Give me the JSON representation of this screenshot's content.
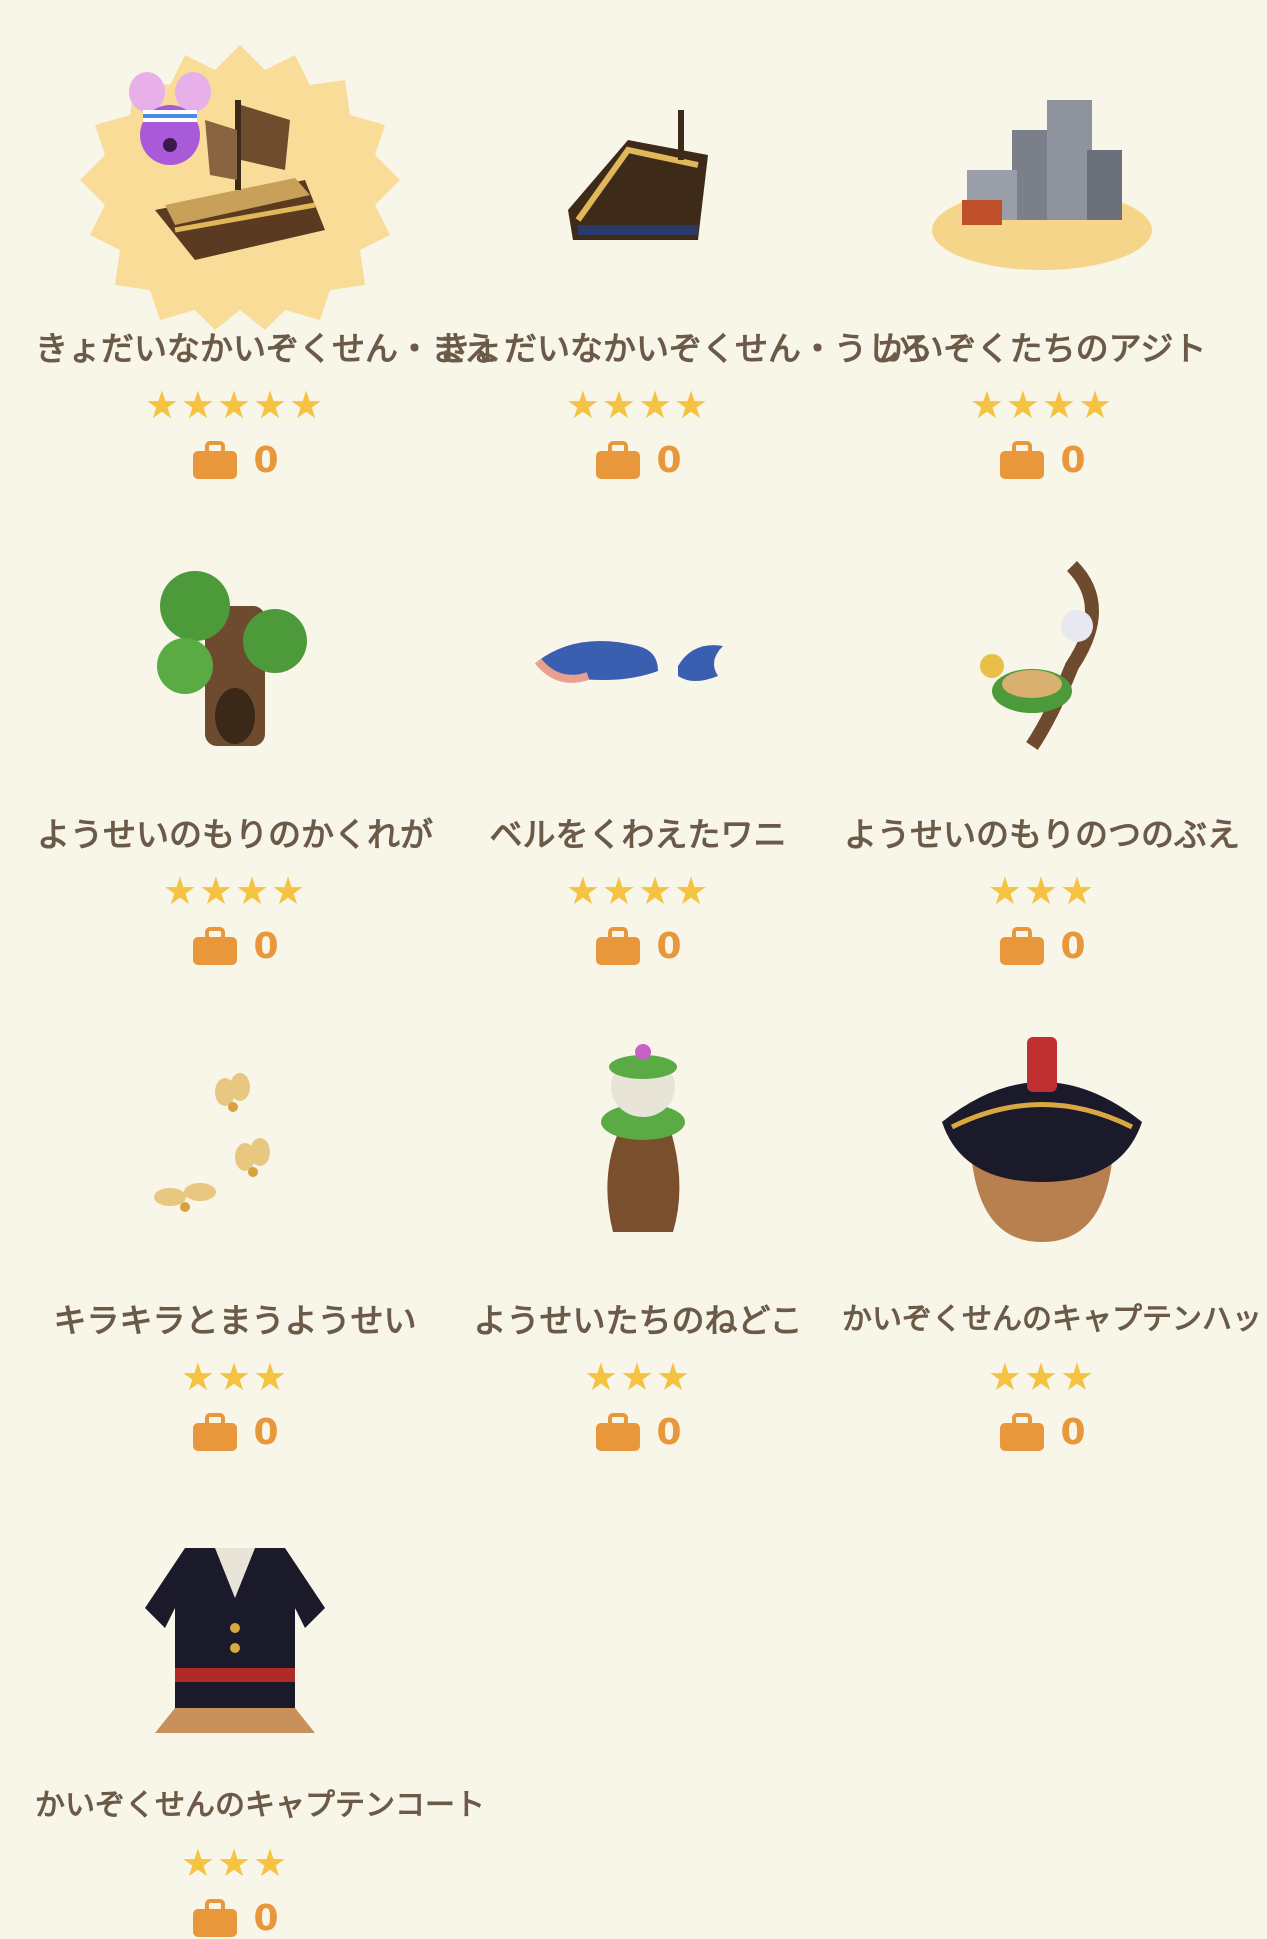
{
  "items": [
    {
      "name": "きょだいなかいぞくせん・まえ",
      "stars": "★★★★★",
      "owned": "0",
      "icon": "pirate-ship-front-icon",
      "highlight": true
    },
    {
      "name": "きょだいなかいぞくせん・うしろ",
      "stars": "★★★★",
      "owned": "0",
      "icon": "pirate-ship-back-icon"
    },
    {
      "name": "かいぞくたちのアジト",
      "stars": "★★★★",
      "owned": "0",
      "icon": "pirate-hideout-icon"
    },
    {
      "name": "ようせいのもりのかくれが",
      "stars": "★★★★",
      "owned": "0",
      "icon": "fairy-forest-hideout-icon"
    },
    {
      "name": "ベルをくわえたワニ",
      "stars": "★★★★",
      "owned": "0",
      "icon": "crocodile-icon"
    },
    {
      "name": "ようせいのもりのつのぶえ",
      "stars": "★★★",
      "owned": "0",
      "icon": "fairy-horn-icon"
    },
    {
      "name": "キラキラとまうようせい",
      "stars": "★★★",
      "owned": "0",
      "icon": "fairies-icon"
    },
    {
      "name": "ようせいたちのねどこ",
      "stars": "★★★",
      "owned": "0",
      "icon": "fairy-bed-icon"
    },
    {
      "name": "かいぞくせんのキャプテンハット",
      "stars": "★★★",
      "owned": "0",
      "icon": "captain-hat-icon"
    },
    {
      "name": "かいぞくせんのキャプテンコート",
      "stars": "★★★",
      "owned": "0",
      "icon": "captain-coat-icon"
    }
  ],
  "colors": {
    "background": "#f8f5e9",
    "star": "#f5c242",
    "count": "#e8973a",
    "text": "#6b5a48"
  }
}
